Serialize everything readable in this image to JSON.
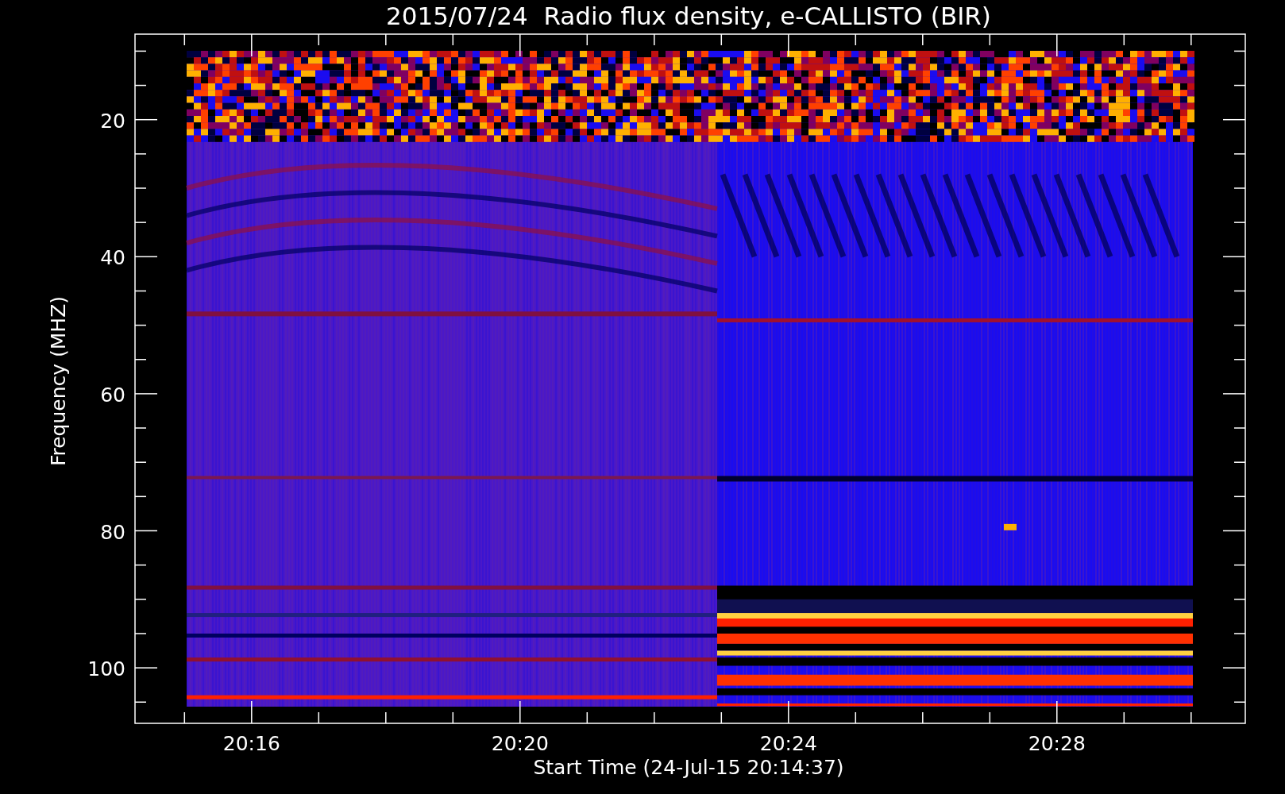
{
  "title": "2015/07/24  Radio flux density, e-CALLISTO (BIR)",
  "y_axis": {
    "label": "Frequency (MHZ)",
    "ticks": [
      "20",
      "40",
      "60",
      "80",
      "100"
    ]
  },
  "x_axis": {
    "label": "Start Time (24-Jul-15 20:14:37)",
    "ticks": [
      "20:16",
      "20:20",
      "20:24",
      "20:28"
    ]
  }
}
